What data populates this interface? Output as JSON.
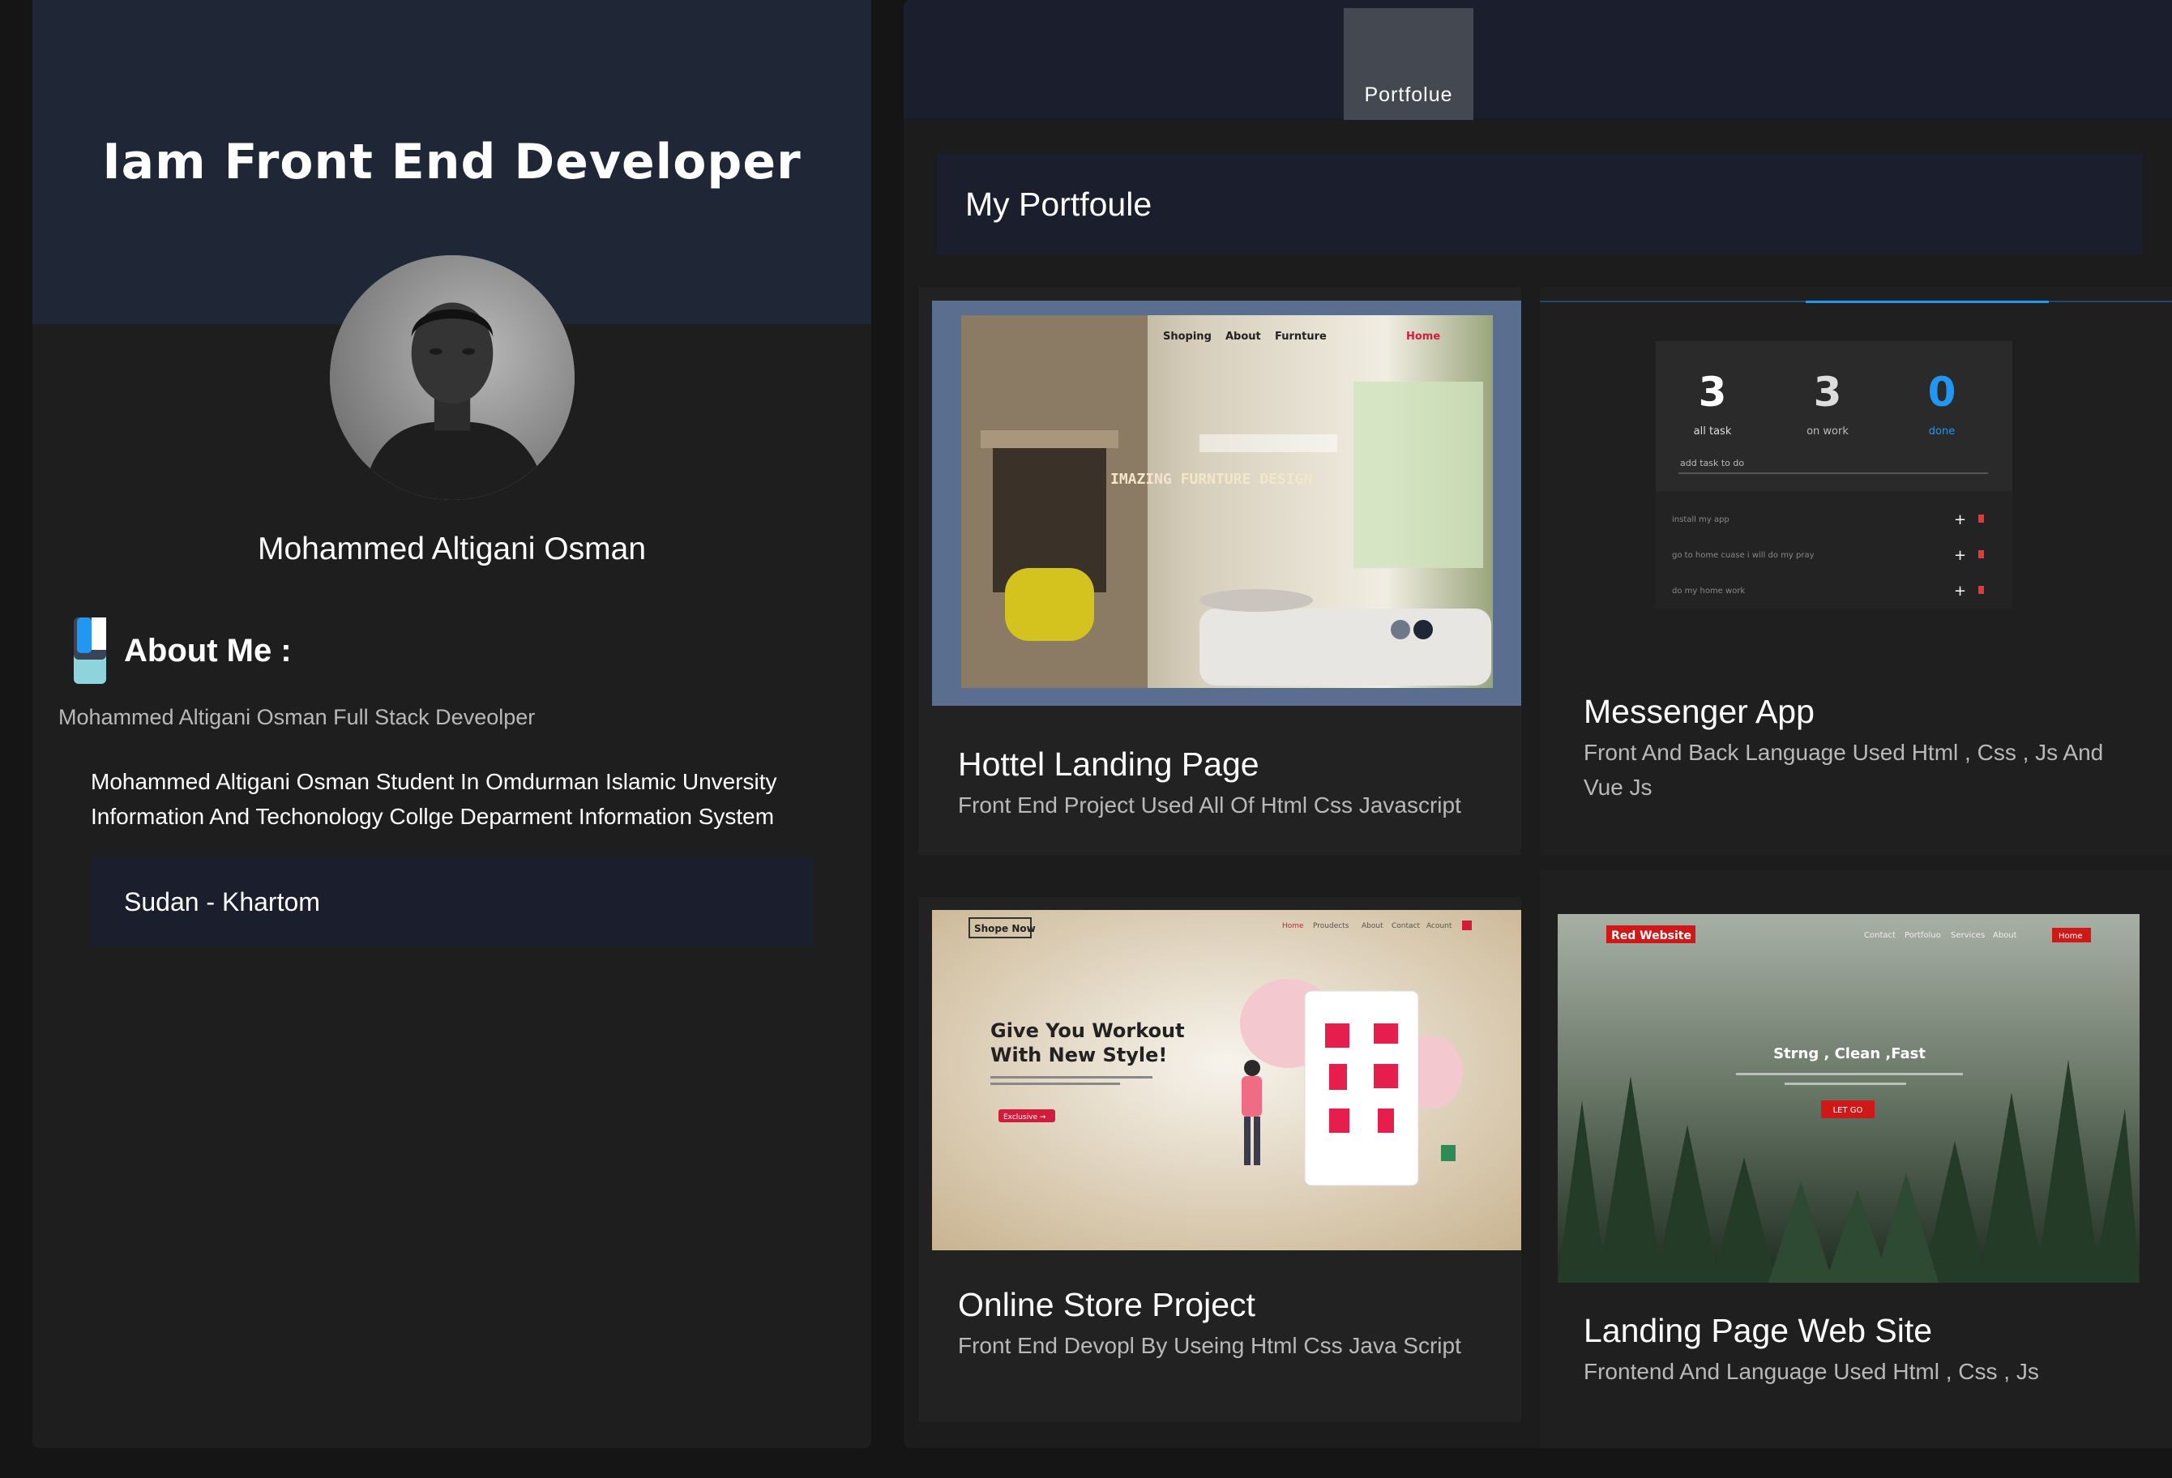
{
  "profile": {
    "headline": "Iam Front End Developer",
    "name": "Mohammed Altigani Osman",
    "about_title": "About Me :",
    "about_subtitle": "Mohammed Altigani Osman Full Stack Deveolper",
    "about_description": "Mohammed Altigani Osman Student In Omdurman Islamic Unversity Information And Techonology Collge Deparment Information System",
    "location": "Sudan - Khartom",
    "avatar_icon": "profile-photo"
  },
  "nav": {
    "tab_label": "Portfolue"
  },
  "portfolio": {
    "section_title": "My Portfoule",
    "projects": [
      {
        "title": "Hottel Landing Page",
        "description": "Front End Project Used All Of Html Css Javascript",
        "thumbnail": {
          "nav_items": [
            "Shoping",
            "About",
            "Furnture",
            "Home"
          ],
          "hero_text": "IMAZING FURNTURE DESIGN"
        }
      },
      {
        "title": "Messenger App",
        "description": "Front And Back Language Used Html , Css , Js And Vue Js",
        "thumbnail": {
          "stats": [
            {
              "value": "3",
              "label": "all task"
            },
            {
              "value": "3",
              "label": "on work"
            },
            {
              "value": "0",
              "label": "done"
            }
          ],
          "input_placeholder": "add task to do",
          "tasks": [
            "install my app",
            "go to home cuase i will do my pray",
            "do my home work"
          ]
        }
      },
      {
        "title": "Online Store Project",
        "description": "Front End Devopl By Useing Html Css Java Script",
        "thumbnail": {
          "logo": "Shope Now",
          "nav_items": [
            "Home",
            "Proudects",
            "About",
            "Contact",
            "Acount"
          ],
          "hero_line1": "Give You Workout",
          "hero_line2": "With New Style!",
          "button": "Exclusive →"
        }
      },
      {
        "title": "Landing Page Web Site",
        "description": "Frontend And Language Used Html , Css , Js",
        "thumbnail": {
          "logo": "Red Website",
          "nav_items": [
            "Contact",
            "Portfoluo",
            "Services",
            "About",
            "Home"
          ],
          "hero_text": "Strng , Clean ,Fast",
          "button": "LET GO"
        }
      }
    ]
  },
  "colors": {
    "page_bg": "#151515",
    "panel_bg": "#1e1e1e",
    "header_bg": "#1f2636",
    "accent_blue": "#2196f3",
    "accent_red": "#e02020"
  }
}
